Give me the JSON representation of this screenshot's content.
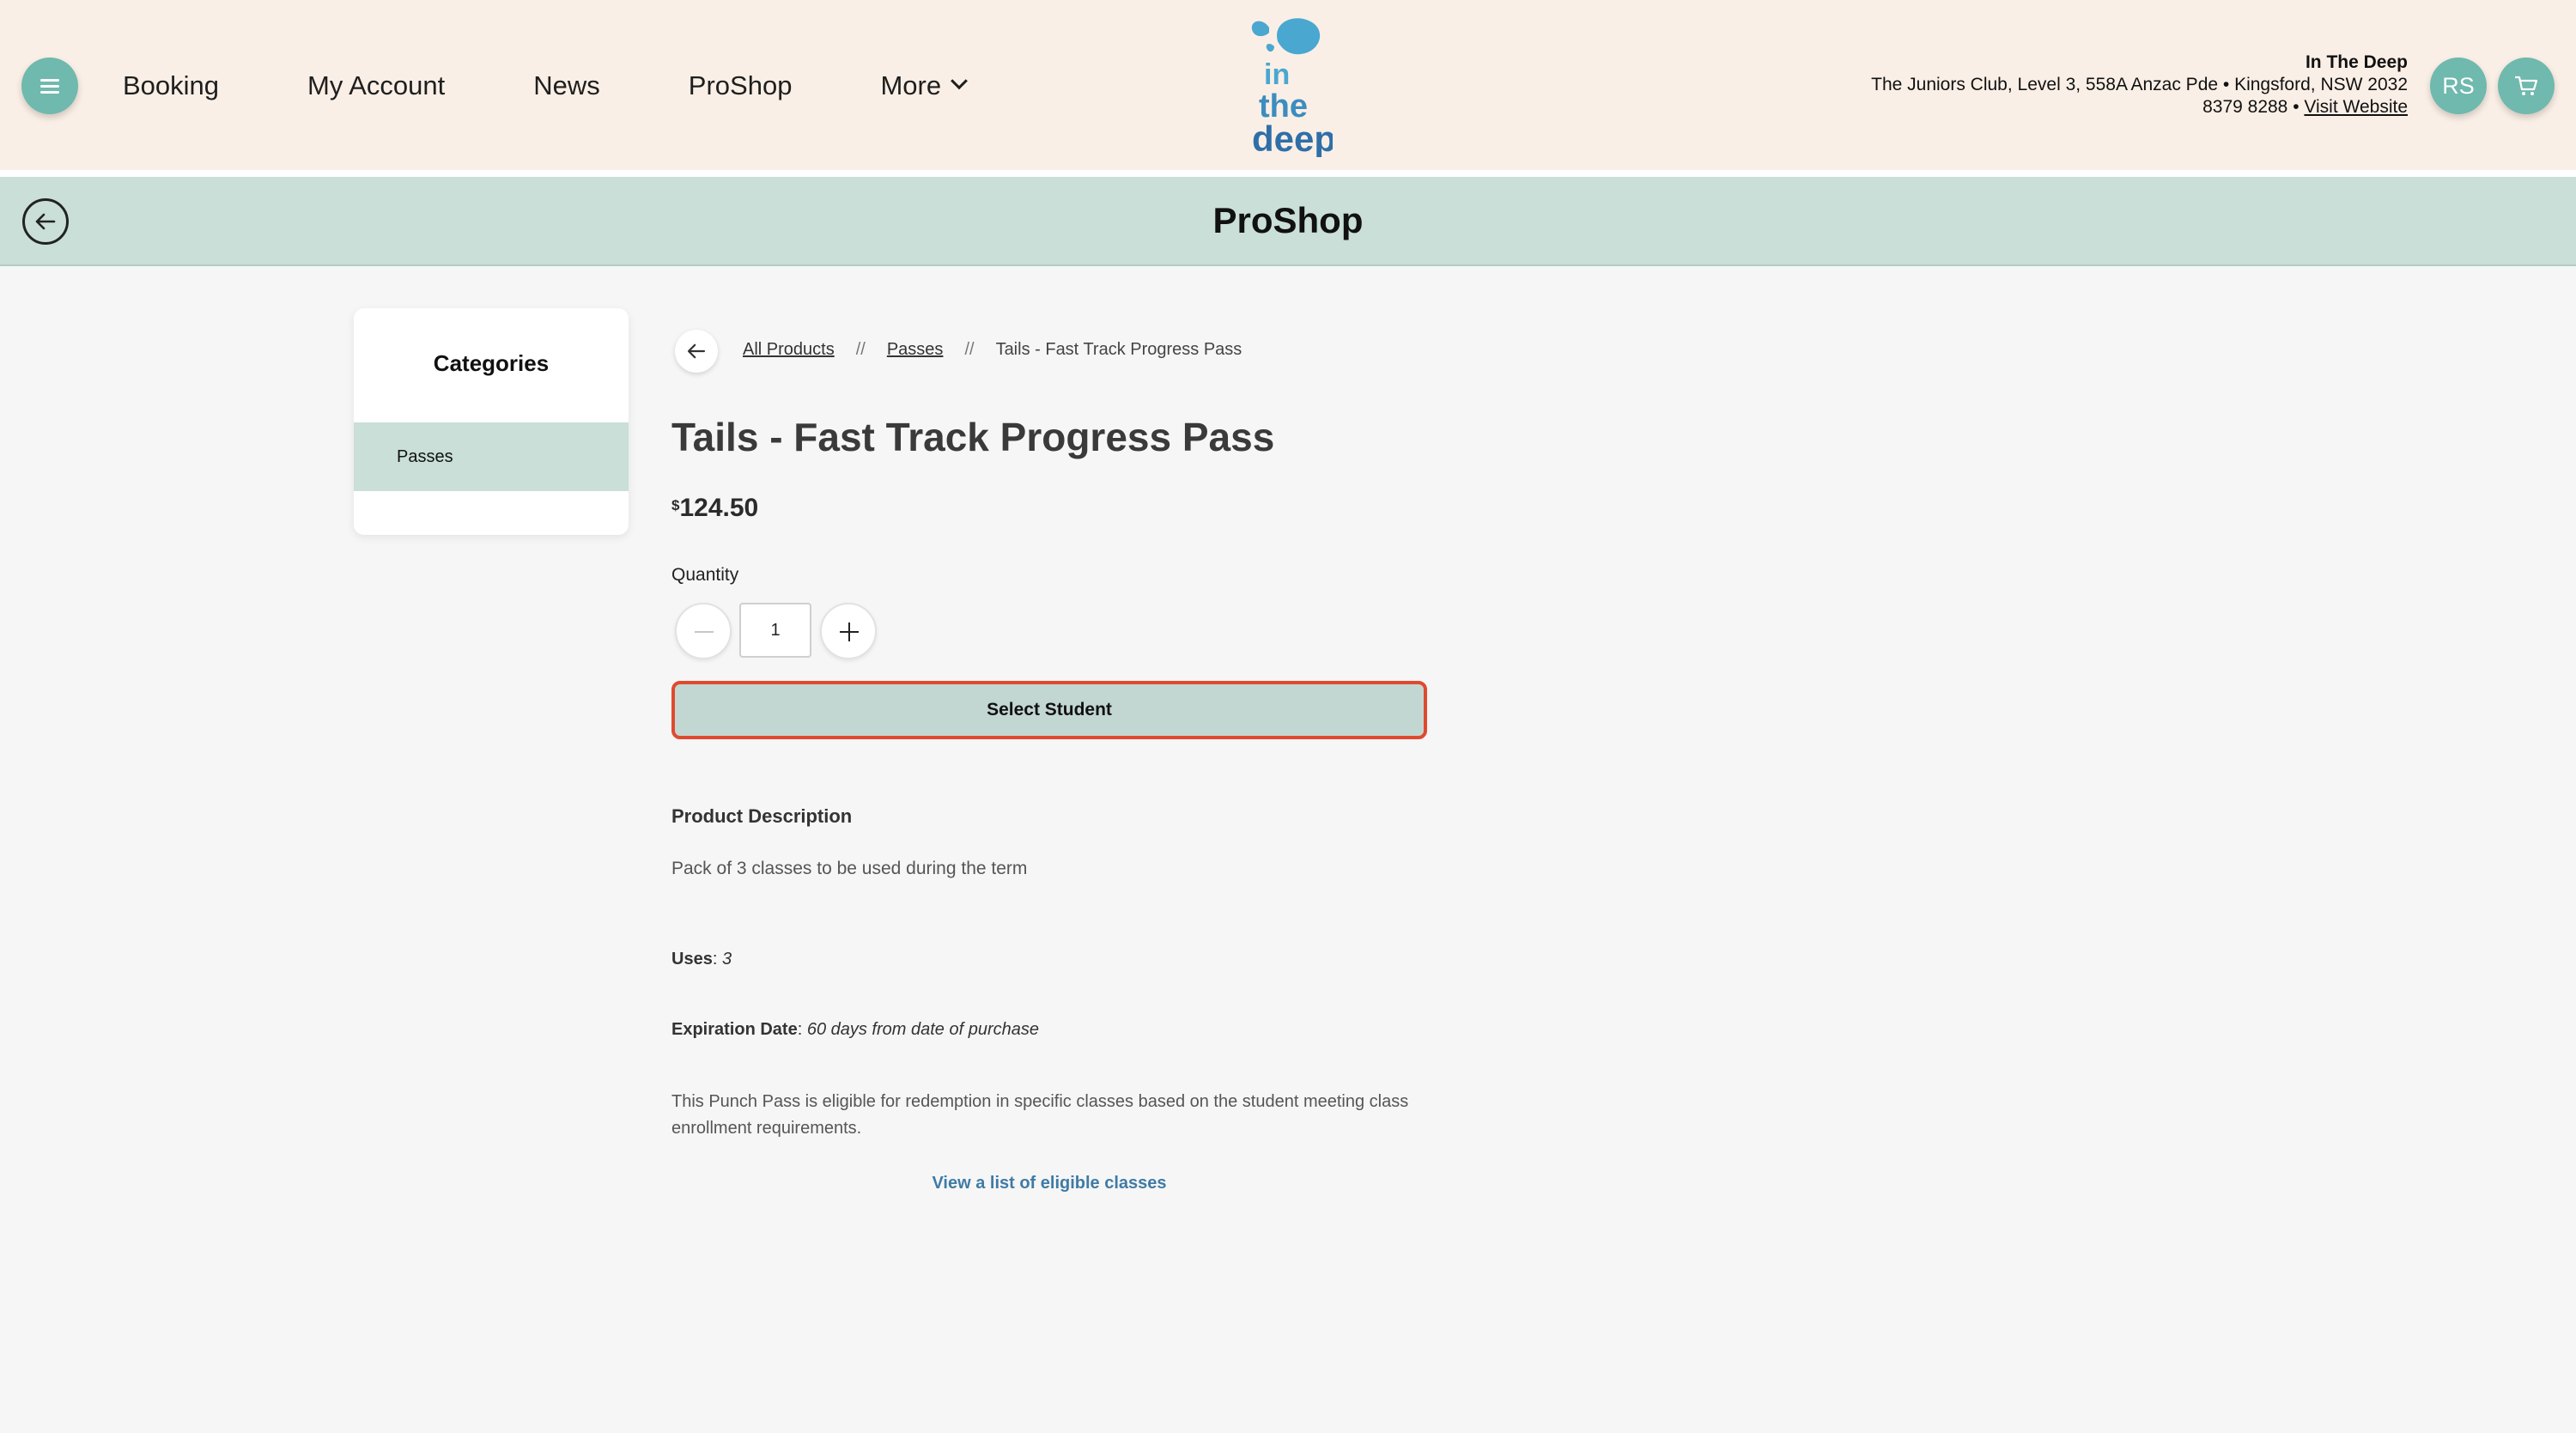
{
  "header": {
    "nav": [
      {
        "label": "Booking"
      },
      {
        "label": "My Account"
      },
      {
        "label": "News"
      },
      {
        "label": "ProShop"
      },
      {
        "label": "More"
      }
    ],
    "logo_text": [
      "in",
      "the",
      "deep"
    ],
    "club": {
      "name": "In The Deep",
      "address": "The Juniors Club, Level 3, 558A Anzac Pde • Kingsford, NSW 2032",
      "phone": "8379 8288 • ",
      "website_link": "Visit Website"
    },
    "avatar_initials": "RS"
  },
  "title_band": {
    "title": "ProShop"
  },
  "sidebar": {
    "title": "Categories",
    "items": [
      {
        "label": "Passes"
      }
    ]
  },
  "breadcrumb": {
    "items": [
      "All Products",
      "Passes",
      "Tails - Fast Track Progress Pass"
    ],
    "separator": "//"
  },
  "product": {
    "title": "Tails - Fast Track Progress Pass",
    "currency": "$",
    "price": "124.50",
    "quantity_label": "Quantity",
    "quantity": "1",
    "select_button": "Select Student",
    "description_heading": "Product Description",
    "description": "Pack of 3 classes to be used during the term",
    "uses_label": "Uses",
    "uses_value": "3",
    "expiry_label": "Expiration Date",
    "expiry_value": "60 days from date of purchase",
    "eligibility_text": "This Punch Pass is eligible for redemption in specific classes based on the student meeting class enrollment requirements.",
    "eligible_link": "View a list of eligible classes"
  },
  "colors": {
    "header_bg": "#faefe6",
    "accent_teal": "#6fb9ae",
    "band_bg": "#c9dfd8",
    "highlight_border": "#e0492f",
    "logo_blue": "#4aa7d0"
  },
  "icons": {
    "menu": "hamburger-icon",
    "back": "arrow-left-icon",
    "cart": "cart-icon",
    "more": "chevron-down-icon"
  }
}
